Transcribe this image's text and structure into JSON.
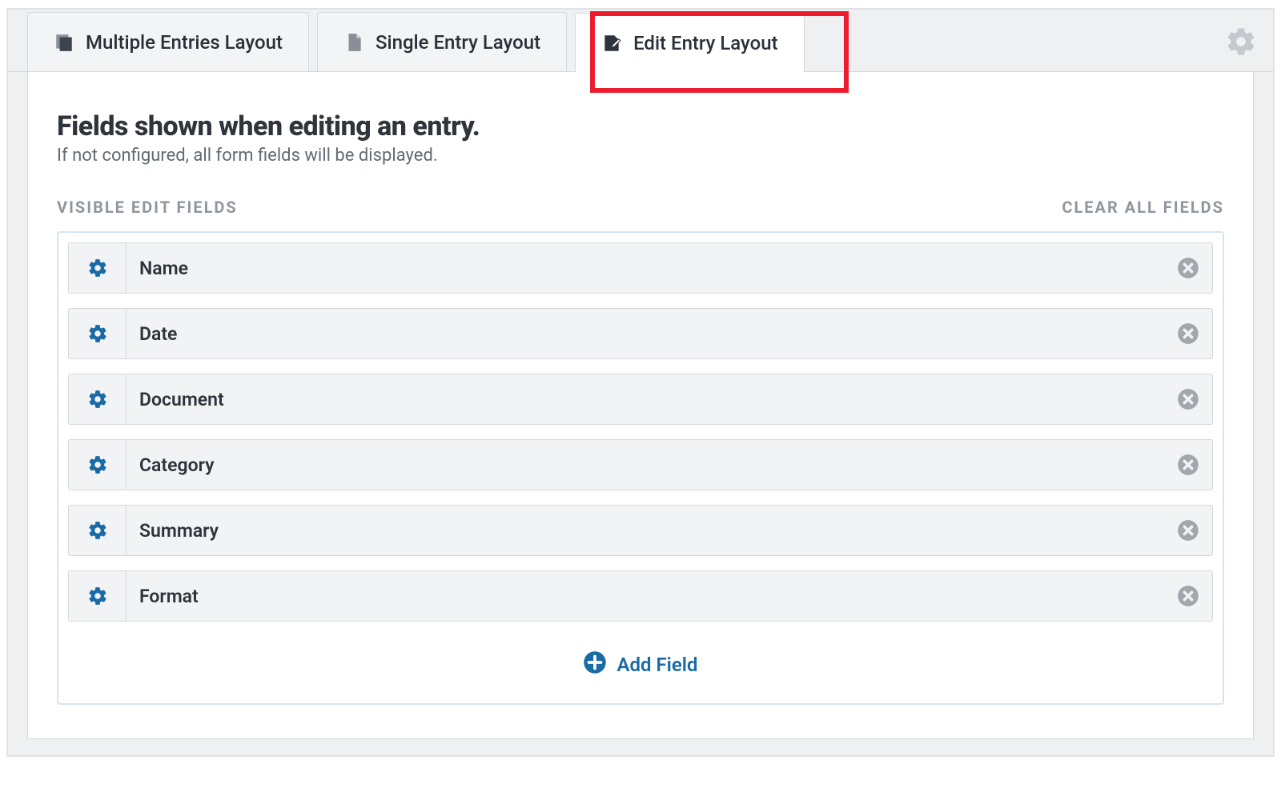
{
  "tabs": [
    {
      "label": "Multiple Entries Layout",
      "icon": "multiple-icon",
      "active": false
    },
    {
      "label": "Single Entry Layout",
      "icon": "single-icon",
      "active": false
    },
    {
      "label": "Edit Entry Layout",
      "icon": "edit-icon",
      "active": true
    }
  ],
  "header": {
    "title": "Fields shown when editing an entry.",
    "subtitle": "If not configured, all form fields will be displayed."
  },
  "section": {
    "label": "VISIBLE EDIT FIELDS",
    "clear": "CLEAR ALL FIELDS"
  },
  "fields": [
    {
      "label": "Name"
    },
    {
      "label": "Date"
    },
    {
      "label": "Document"
    },
    {
      "label": "Category"
    },
    {
      "label": "Summary"
    },
    {
      "label": "Format"
    }
  ],
  "actions": {
    "add_field": "Add Field"
  }
}
